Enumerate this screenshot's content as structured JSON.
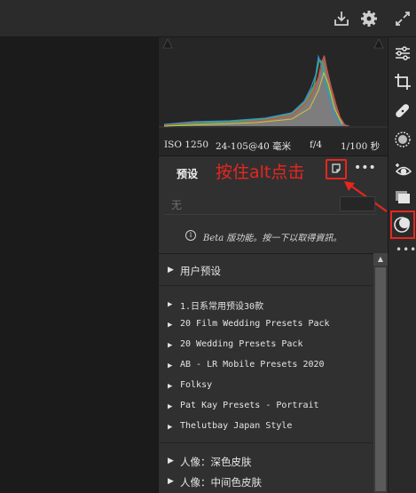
{
  "topbar": {
    "export_icon": "download-tray-icon",
    "settings_icon": "gear-icon",
    "expand_icon": "expand-arrows-icon"
  },
  "exif": {
    "iso": "ISO 1250",
    "focal": "24-105@40 毫米",
    "aperture": "f/4",
    "shutter": "1/100 秒"
  },
  "presets": {
    "title": "预设",
    "annotation": "按住alt点击",
    "new_preset_icon": "new-preset-icon",
    "more_label": "•••",
    "amount_label": "无",
    "beta_notice": "Beta 版功能。按一下以取得資訊。",
    "groups": [
      {
        "label": "用户预设",
        "mono": false
      },
      {
        "label": "1.日系常用预设30款",
        "mono": true
      },
      {
        "label": "20 Film Wedding Presets Pack",
        "mono": true
      },
      {
        "label": "20 Wedding Presets Pack",
        "mono": true
      },
      {
        "label": "AB - LR Mobile Presets 2020",
        "mono": true
      },
      {
        "label": "Folksy",
        "mono": true
      },
      {
        "label": "Pat Kay Presets - Portrait",
        "mono": true
      },
      {
        "label": "Thelutbay Japan Style",
        "mono": true
      },
      {
        "label": "人像：深色皮肤",
        "mono": false
      },
      {
        "label": "人像：中间色皮肤",
        "mono": false
      }
    ]
  },
  "tools": [
    "sliders-icon",
    "crop-icon",
    "healing-brush-icon",
    "radial-mask-icon",
    "red-eye-icon",
    "snapshots-icon",
    "presets-icon"
  ],
  "colors": {
    "accent_red": "#e8261f"
  }
}
